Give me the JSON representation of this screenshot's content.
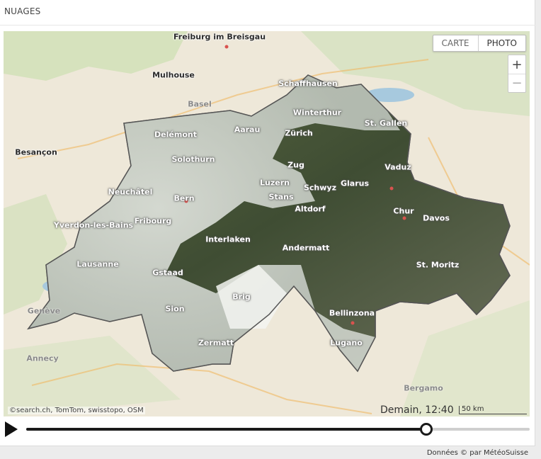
{
  "panel": {
    "title": "NUAGES"
  },
  "map": {
    "view_toggle": [
      {
        "label": "CARTE",
        "active": false
      },
      {
        "label": "PHOTO",
        "active": true
      }
    ],
    "zoom": {
      "in": "+",
      "out": "−"
    },
    "attribution": "©search.ch, TomTom, swisstopo, OSM",
    "scale_label": "50 km",
    "places": [
      {
        "name": "Freiburg im Breisgau",
        "style": "dark"
      },
      {
        "name": "Mulhouse",
        "style": "dark"
      },
      {
        "name": "Basel",
        "style": "faded"
      },
      {
        "name": "Schaffhausen",
        "style": "light"
      },
      {
        "name": "Winterthur",
        "style": "light"
      },
      {
        "name": "St. Gallen",
        "style": "light"
      },
      {
        "name": "Delémont",
        "style": "light"
      },
      {
        "name": "Aarau",
        "style": "light"
      },
      {
        "name": "Zürich",
        "style": "light"
      },
      {
        "name": "Besançon",
        "style": "dark"
      },
      {
        "name": "Solothurn",
        "style": "light"
      },
      {
        "name": "Zug",
        "style": "light"
      },
      {
        "name": "Vaduz",
        "style": "light"
      },
      {
        "name": "Luzern",
        "style": "light"
      },
      {
        "name": "Glarus",
        "style": "light"
      },
      {
        "name": "Schwyz",
        "style": "light"
      },
      {
        "name": "Neuchâtel",
        "style": "light"
      },
      {
        "name": "Stans",
        "style": "light"
      },
      {
        "name": "Bern",
        "style": "light"
      },
      {
        "name": "Altdorf",
        "style": "light"
      },
      {
        "name": "Chur",
        "style": "light"
      },
      {
        "name": "Davos",
        "style": "light"
      },
      {
        "name": "Fribourg",
        "style": "light"
      },
      {
        "name": "Yverdon-les-Bains",
        "style": "light"
      },
      {
        "name": "Interlaken",
        "style": "light"
      },
      {
        "name": "Andermatt",
        "style": "light"
      },
      {
        "name": "Lausanne",
        "style": "light"
      },
      {
        "name": "St. Moritz",
        "style": "light"
      },
      {
        "name": "Gstaad",
        "style": "light"
      },
      {
        "name": "Brig",
        "style": "light"
      },
      {
        "name": "Genève",
        "style": "faded"
      },
      {
        "name": "Sion",
        "style": "light"
      },
      {
        "name": "Bellinzona",
        "style": "light"
      },
      {
        "name": "Zermatt",
        "style": "light"
      },
      {
        "name": "Lugano",
        "style": "light"
      },
      {
        "name": "Annecy",
        "style": "faded"
      },
      {
        "name": "Bergamo",
        "style": "faded"
      }
    ]
  },
  "player": {
    "timestamp": "Demain, 12:40",
    "progress": 0.795,
    "play_icon": "play-icon"
  },
  "footer": "Données © par MétéoSuisse",
  "colors": {
    "track_fill": "#1a1a1a",
    "track_empty": "#cfcfcf",
    "border_switzerland": "#555555"
  }
}
